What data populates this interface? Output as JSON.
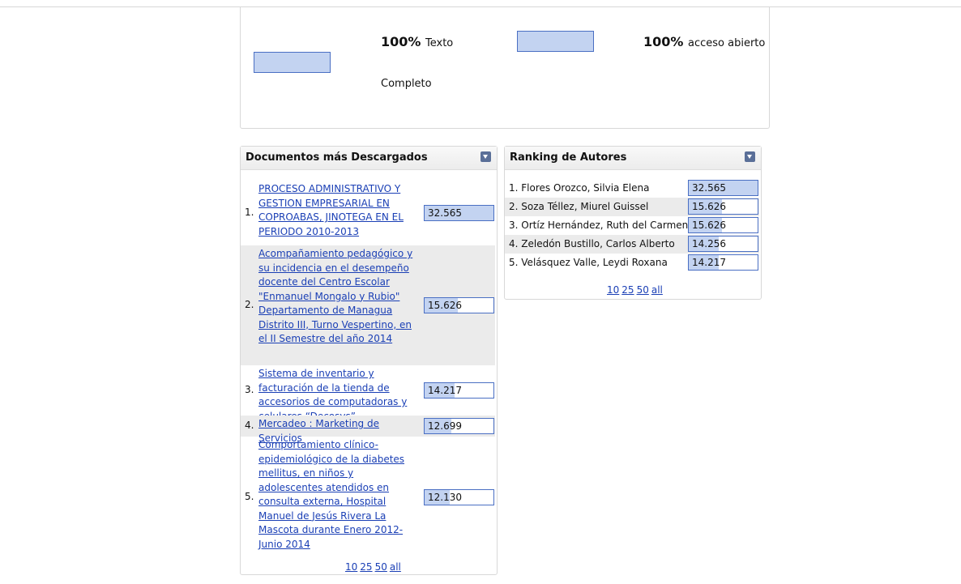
{
  "stats": {
    "full_text": {
      "value": "100%",
      "label_line1": "Texto",
      "label_line2": "Completo",
      "fraction": 1.0
    },
    "open_access": {
      "value": "100%",
      "label": "acceso abierto",
      "fraction": 1.0
    }
  },
  "downloads": {
    "title": "Documentos más Descargados",
    "items": [
      {
        "rank": "1.",
        "title": "PROCESO ADMINISTRATIVO Y GESTION EMPRESARIAL EN COPROABAS, JINOTEGA EN EL PERIODO 2010-2013",
        "count": "32.565",
        "fraction": 1.0
      },
      {
        "rank": "2.",
        "title": "Acompañamiento pedagógico y su incidencia en el desempeño docente del Centro Escolar \"Enmanuel Mongalo y Rubio\" Departamento de Managua Distrito III, Turno Vespertino, en el II Semestre del año 2014",
        "count": "15.626",
        "fraction": 0.48
      },
      {
        "rank": "3.",
        "title": "Sistema de inventario y facturación de la tienda de accesorios de computadoras y celulares “Decosys”",
        "count": "14.217",
        "fraction": 0.44
      },
      {
        "rank": "4.",
        "title": "Mercadeo : Marketing de Servicios",
        "count": "12.699",
        "fraction": 0.39
      },
      {
        "rank": "5.",
        "title": "Comportamiento clínico-epidemiológico de la diabetes mellitus, en niños y adolescentes atendidos en consulta externa, Hospital Manuel de Jesús Rivera La Mascota durante Enero 2012-Junio 2014",
        "count": "12.130",
        "fraction": 0.37
      }
    ],
    "pager": [
      "10",
      "25",
      "50",
      "all"
    ]
  },
  "authors": {
    "title": "Ranking de Autores",
    "items": [
      {
        "rank": "1.",
        "name": "Flores Orozco, Silvia Elena",
        "count": "32.565",
        "fraction": 1.0
      },
      {
        "rank": "2.",
        "name": "Soza Téllez, Miurel Guissel",
        "count": "15.626",
        "fraction": 0.48
      },
      {
        "rank": "3.",
        "name": "Ortíz Hernández, Ruth del Carmen",
        "count": "15.626",
        "fraction": 0.48
      },
      {
        "rank": "4.",
        "name": "Zeledón Bustillo, Carlos Alberto",
        "count": "14.256",
        "fraction": 0.44
      },
      {
        "rank": "5.",
        "name": "Velásquez Valle, Leydi Roxana",
        "count": "14.217",
        "fraction": 0.44
      }
    ],
    "pager": [
      "10",
      "25",
      "50",
      "all"
    ]
  }
}
